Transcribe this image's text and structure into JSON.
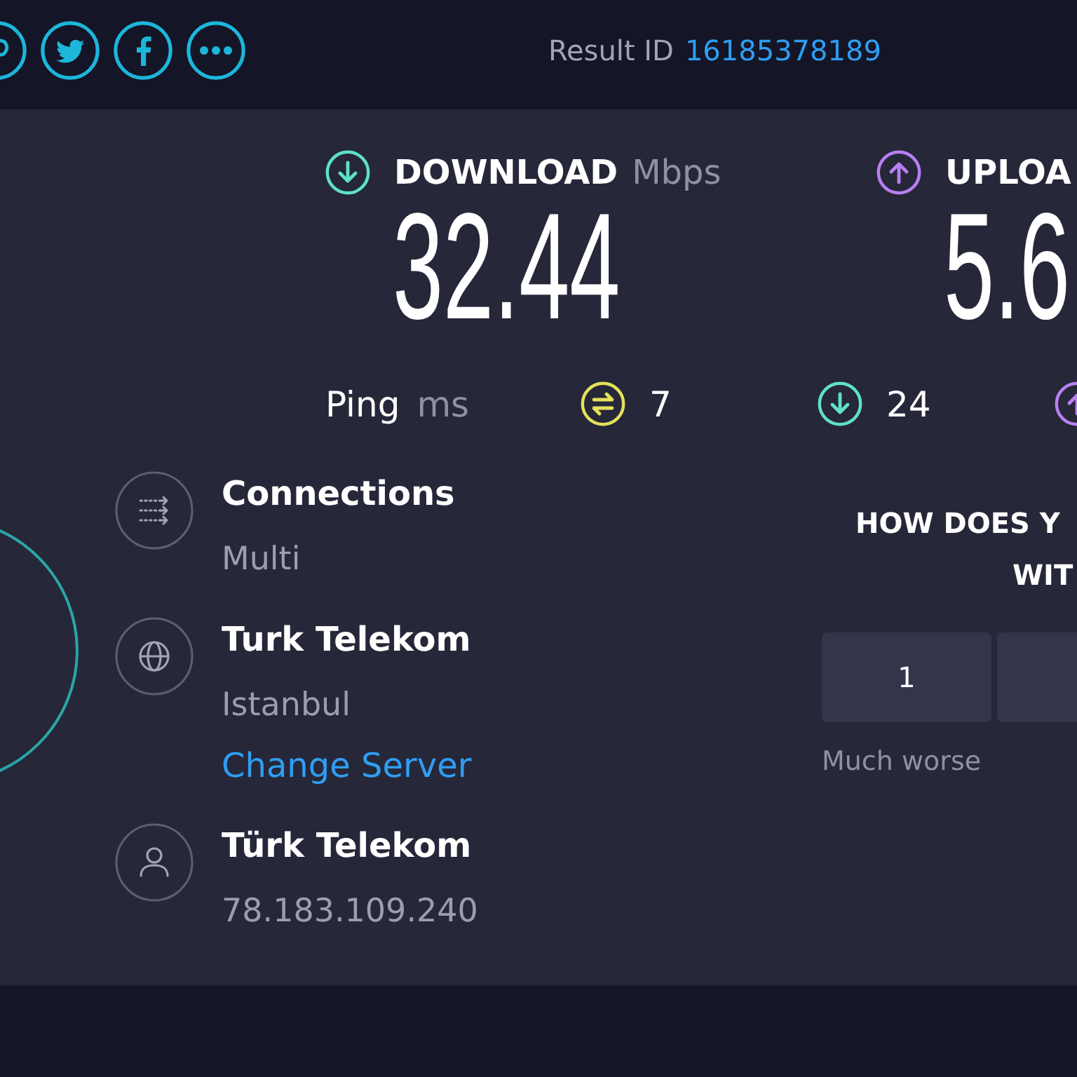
{
  "result": {
    "label": "Result ID",
    "id": "16185378189"
  },
  "speeds": [
    {
      "kind": "download",
      "label": "DOWNLOAD",
      "unit": "Mbps",
      "value": "32.44"
    },
    {
      "kind": "upload",
      "label": "UPLOA",
      "value": "5.6"
    }
  ],
  "ping": {
    "label": "Ping",
    "unit": "ms",
    "readings": [
      {
        "kind": "idle",
        "value": "7"
      },
      {
        "kind": "download",
        "value": "24"
      },
      {
        "kind": "upload"
      }
    ]
  },
  "info": [
    {
      "kind": "connections",
      "title": "Connections",
      "detail": "Multi"
    },
    {
      "kind": "server",
      "title": "Turk Telekom",
      "detail": "Istanbul",
      "link": "Change Server"
    },
    {
      "kind": "provider",
      "title": "Türk Telekom",
      "detail": "78.183.109.240"
    }
  ],
  "survey": {
    "question_lines": [
      "HOW DOES Y",
      "WIT"
    ],
    "options": [
      {
        "label": "1",
        "selected": false
      },
      {
        "selected": false
      }
    ],
    "low_label": "Much worse"
  }
}
